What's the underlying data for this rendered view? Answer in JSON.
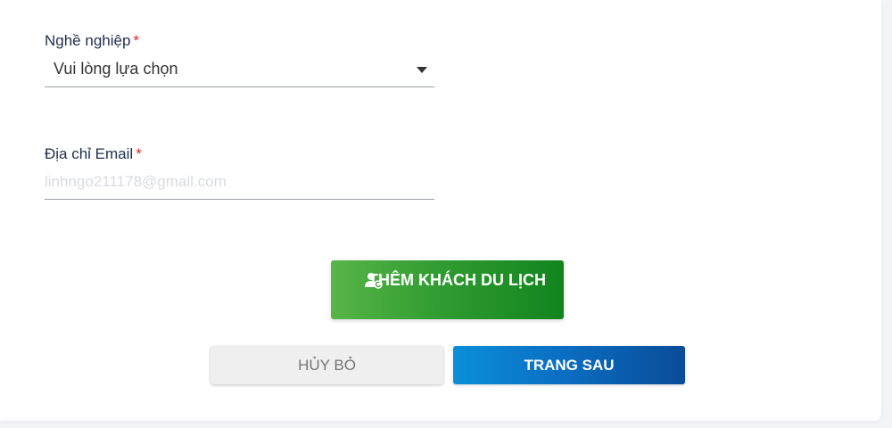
{
  "occupation": {
    "label": "Nghề nghiệp",
    "required_mark": "*",
    "selected_value": "Vui lòng lựa chọn"
  },
  "email": {
    "label": "Địa chỉ Email",
    "required_mark": "*",
    "placeholder": "linhngo211178@gmail.com"
  },
  "buttons": {
    "add_traveler_label": "THÊM KHÁCH DU LỊCH",
    "cancel_label": "HỦY BỎ",
    "next_label": "TRANG SAU"
  },
  "colors": {
    "required": "#e02424",
    "add_button": "#2e9a2f",
    "next_button": "#0b6cc0",
    "cancel_button": "#efefef"
  },
  "icons": {
    "add_traveler": "user-add-icon",
    "select_caret": "caret-down-icon"
  }
}
